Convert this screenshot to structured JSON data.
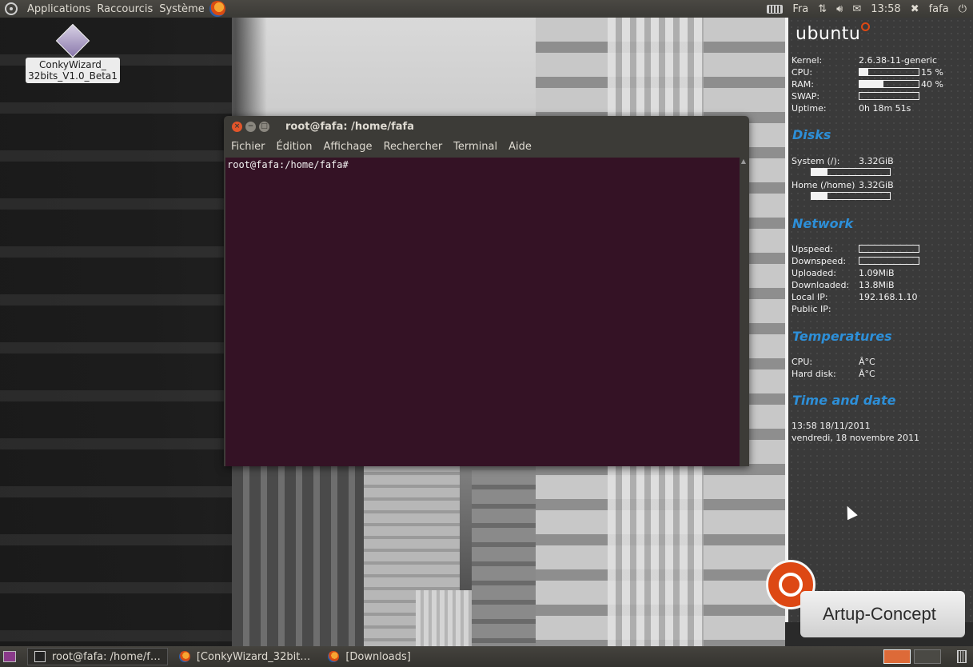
{
  "top_panel": {
    "menus": [
      "Applications",
      "Raccourcis",
      "Système"
    ],
    "keyboard_layout": "Fra",
    "clock": "13:58",
    "user": "fafa"
  },
  "desktop": {
    "icon_label_line1": "ConkyWizard_",
    "icon_label_line2": "32bits_V1.0_Beta1"
  },
  "terminal": {
    "title": "root@fafa: /home/fafa",
    "menus": [
      "Fichier",
      "Édition",
      "Affichage",
      "Rechercher",
      "Terminal",
      "Aide"
    ],
    "prompt": "root@fafa:/home/fafa#"
  },
  "conky": {
    "brand": "ubuntu",
    "system": {
      "kernel_label": "Kernel:",
      "kernel": "2.6.38-11-generic",
      "cpu_label": "CPU:",
      "cpu_pct": "15 %",
      "cpu_level": 0.15,
      "ram_label": "RAM:",
      "ram_pct": "40 %",
      "ram_level": 0.4,
      "swap_label": "SWAP:",
      "swap_level": 0.0,
      "uptime_label": "Uptime:",
      "uptime": "0h 18m 51s"
    },
    "disks": {
      "heading": "Disks",
      "system_label": "System (/):",
      "system_value": "3.32GiB",
      "system_level": 0.2,
      "home_label": "Home (/home)",
      "home_value": "3.32GiB",
      "home_level": 0.2
    },
    "network": {
      "heading": "Network",
      "upspeed_label": "Upspeed:",
      "downspeed_label": "Downspeed:",
      "uploaded_label": "Uploaded:",
      "uploaded": "1.09MiB",
      "downloaded_label": "Downloaded:",
      "downloaded": "13.8MiB",
      "local_ip_label": "Local IP:",
      "local_ip": "192.168.1.10",
      "public_ip_label": "Public IP:",
      "public_ip": ""
    },
    "temperatures": {
      "heading": "Temperatures",
      "cpu_label": "CPU:",
      "cpu": "Â°C",
      "hdd_label": "Hard disk:",
      "hdd": "Â°C"
    },
    "time": {
      "heading": "Time and date",
      "line1": "13:58  18/11/2011",
      "line2": "vendredi, 18 novembre 2011"
    }
  },
  "badge": {
    "text": "Artup-Concept"
  },
  "taskbar": {
    "tasks": [
      "root@fafa: /home/f…",
      "[ConkyWizard_32bit…",
      "[Downloads]"
    ]
  },
  "colors": {
    "terminal_bg": "#340f24",
    "accent_orange": "#dd4814",
    "conky_heading": "#2d8fd8"
  }
}
